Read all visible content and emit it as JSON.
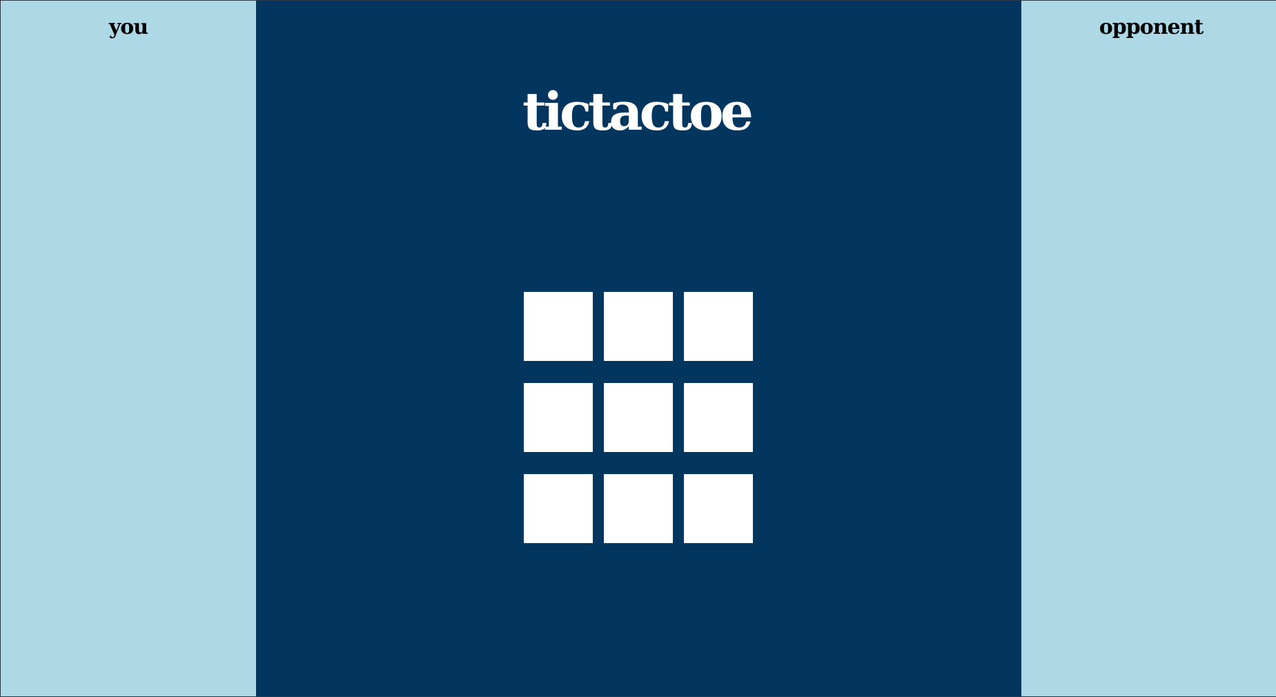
{
  "players": {
    "left_label": "you",
    "right_label": "opponent"
  },
  "game": {
    "title": "tictactoe",
    "board": [
      [
        "",
        "",
        ""
      ],
      [
        "",
        "",
        ""
      ],
      [
        "",
        "",
        ""
      ]
    ]
  },
  "colors": {
    "side_panel": "#add8e6",
    "board_background": "#03365e",
    "cell": "#ffffff",
    "title_text": "#ffffff",
    "side_text": "#000000"
  }
}
